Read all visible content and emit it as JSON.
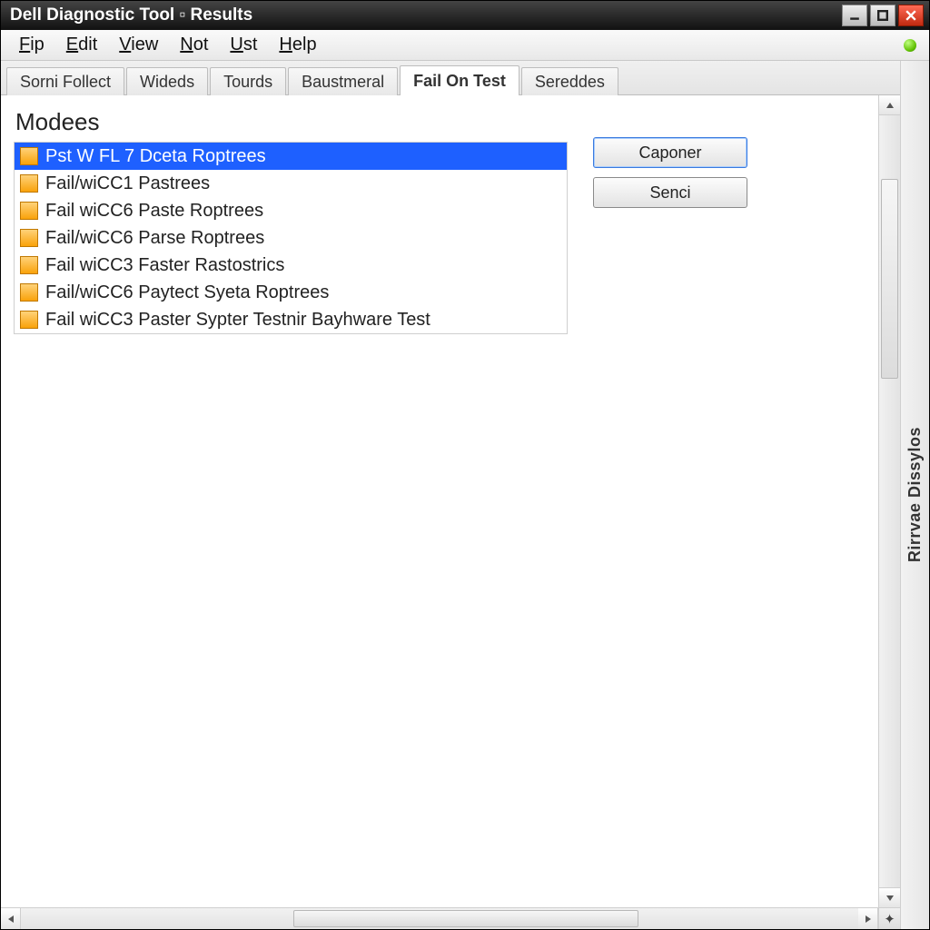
{
  "window": {
    "title": "Dell Diagnostic Tool ▫ Results"
  },
  "menubar": {
    "items": [
      {
        "label": "Fip",
        "u": 0
      },
      {
        "label": "Edit",
        "u": 0
      },
      {
        "label": "View",
        "u": 0
      },
      {
        "label": "Not",
        "u": 0
      },
      {
        "label": "Ust",
        "u": 0
      },
      {
        "label": "Help",
        "u": 0
      }
    ]
  },
  "tabs": {
    "items": [
      {
        "label": "Sorni Follect"
      },
      {
        "label": "Wideds"
      },
      {
        "label": "Tourds"
      },
      {
        "label": "Baustmeral"
      },
      {
        "label": "Fail On Test"
      },
      {
        "label": "Sereddes"
      }
    ],
    "active_index": 4
  },
  "content": {
    "heading": "Modees",
    "list": {
      "items": [
        "Pst W FL 7 Dceta Roptrees",
        "Fail/wiCC1 Pastrees",
        "Fail wiCC6 Paste Roptrees",
        "Fail/wiCC6 Parse Roptrees",
        "Fail wiCC3 Faster Rastostrics",
        "Fail/wiCC6 Paytect Syeta Roptrees",
        "Fail wiCC3 Paster Sypter Testnir Bayhware Test"
      ],
      "selected_index": 0
    },
    "buttons": {
      "primary": "Caponer",
      "secondary": "Senci"
    }
  },
  "side_panel": {
    "label": "Rirrvae Dissylos"
  }
}
